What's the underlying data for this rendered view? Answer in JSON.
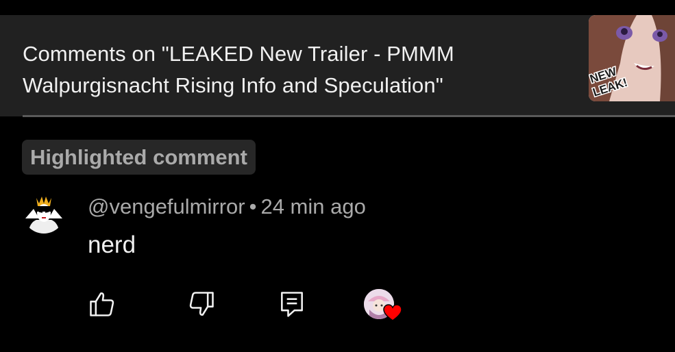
{
  "header": {
    "title": "Comments on \"LEAKED New Trailer - PMMM Walpurgisnacht Rising Info and Speculation\"",
    "thumbnail_text": "NEW LEAK!"
  },
  "highlighted_chip": "Highlighted comment",
  "comment": {
    "author": "@vengefulmirror",
    "separator": "•",
    "time": "24 min ago",
    "text": "nerd"
  },
  "actions": {
    "icons": [
      "thumbs-up-icon",
      "thumbs-down-icon",
      "reply-icon",
      "creator-heart-icon"
    ]
  },
  "colors": {
    "background": "#000000",
    "header_background": "#212121",
    "secondary_text": "#aaaaaa",
    "primary_text": "#f1f1f1",
    "heart": "#ff0000"
  }
}
